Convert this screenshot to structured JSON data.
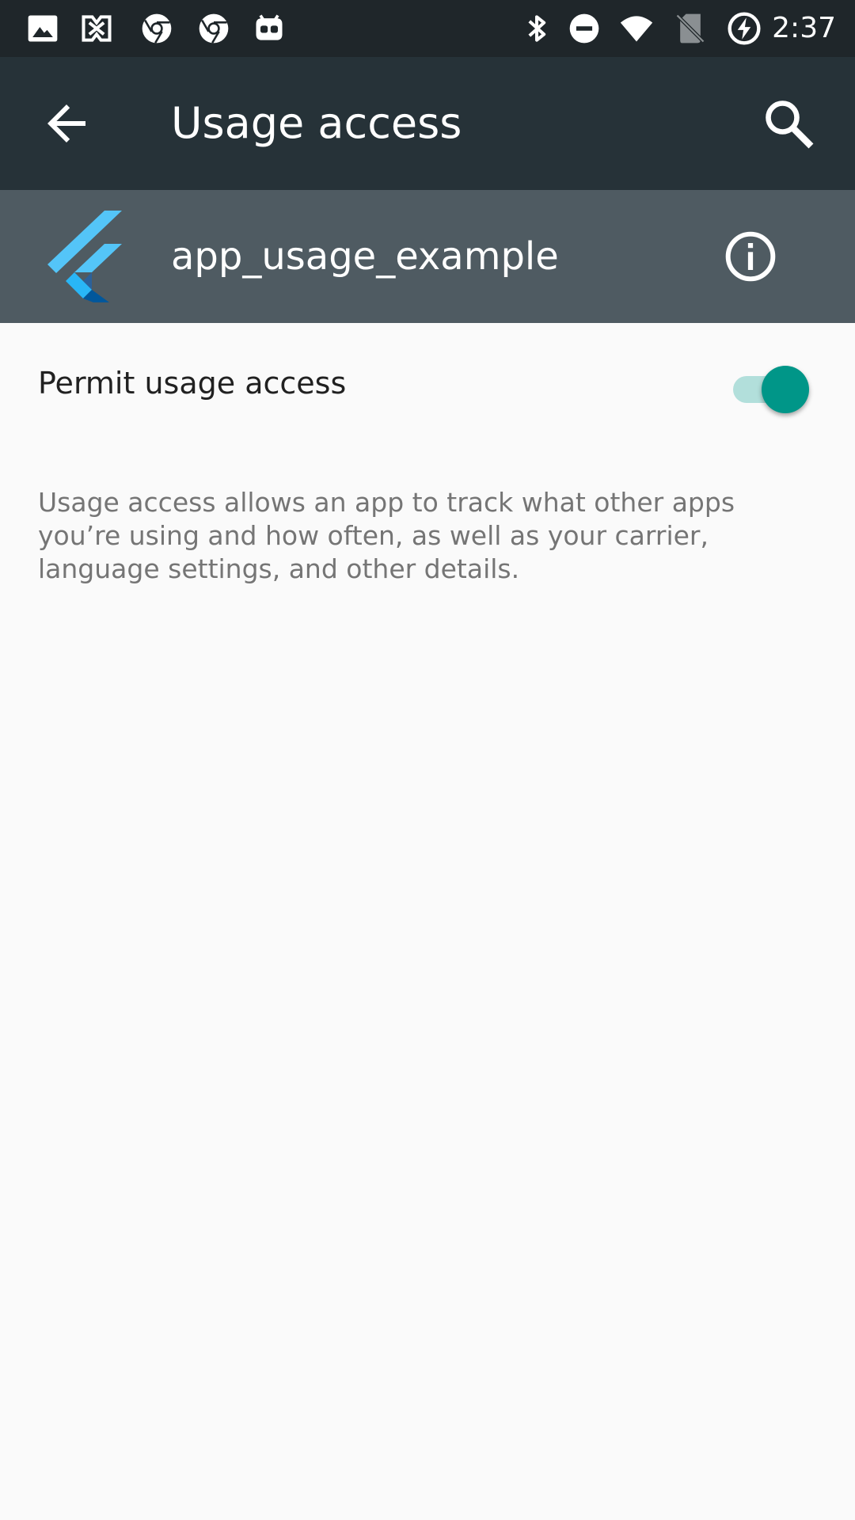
{
  "status_bar": {
    "time": "2:37",
    "left_icons": [
      "image-icon",
      "crossed-arrows-icon",
      "chrome-icon",
      "chrome-icon",
      "cyanogen-icon"
    ],
    "right_icons": [
      "bluetooth-icon",
      "do-not-disturb-icon",
      "wifi-icon",
      "no-sim-icon",
      "battery-charging-icon"
    ]
  },
  "toolbar": {
    "title": "Usage access",
    "back_icon": "arrow-back-icon",
    "search_icon": "search-icon"
  },
  "app": {
    "name": "app_usage_example",
    "icon": "flutter-icon",
    "info_icon": "info-icon"
  },
  "permit": {
    "label": "Permit usage access",
    "enabled": true
  },
  "description": "Usage access allows an app to track what other apps you’re using and how often, as well as your carrier, language settings, and other details.",
  "colors": {
    "status_bar": "#1f262a",
    "toolbar": "#263238",
    "app_row": "#4f5b62",
    "background": "#fafafa",
    "accent": "#009688",
    "accent_track": "#b2dfdb"
  }
}
